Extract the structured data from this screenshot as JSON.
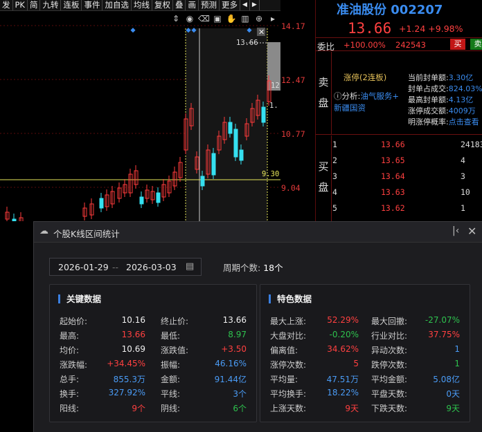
{
  "toolbar": {
    "items": [
      "发",
      "PK",
      "简",
      "九转",
      "连板",
      "事件",
      "加自选",
      "均线",
      "复权",
      "叠",
      "画",
      "预测",
      "更多"
    ],
    "nav_prev": "◀",
    "nav_next": "▶"
  },
  "chart": {
    "price_labels": [
      "14.17",
      "12.47",
      "10.77",
      "9.04"
    ],
    "marker_high": "13.66",
    "marker_mid": "12",
    "marker_one": "1.",
    "marker_low": "9.30"
  },
  "quote": {
    "title": "准油股份 002207",
    "price": "13.66",
    "change": "+1.24",
    "change_pct": "+9.98%",
    "weibi_label": "委比",
    "weibi": "+100.00%",
    "weicha": "242543",
    "sell_btn": "买",
    "buy_btn": "卖",
    "sell_side": "卖盘",
    "buy_side": "买盘",
    "limit_status": "涨停(2连板)",
    "analysis_prefix": "分析:",
    "analysis_value": "油气服务+",
    "analysis_value2": "新疆国资",
    "fields": [
      {
        "label": "当前封单额:",
        "value": "3.30亿"
      },
      {
        "label": "封单占成交:",
        "value": "824.03%"
      },
      {
        "label": "最高封单额:",
        "value": "4.13亿"
      },
      {
        "label": "涨停成交额:",
        "value": "4009万"
      },
      {
        "label": "明涨停概率:",
        "value": "点击查看"
      }
    ],
    "bids": [
      {
        "i": "1",
        "p": "13.66",
        "q": "24183"
      },
      {
        "i": "2",
        "p": "13.65",
        "q": "4"
      },
      {
        "i": "3",
        "p": "13.64",
        "q": "3"
      },
      {
        "i": "4",
        "p": "13.63",
        "q": "10"
      },
      {
        "i": "5",
        "p": "13.62",
        "q": "1"
      }
    ]
  },
  "dialog": {
    "title": "个股K线区间统计",
    "start_date": "2026-01-29",
    "sep": "--",
    "end_date": "2026-03-03",
    "period_label": "周期个数:",
    "period_value": "18个",
    "key_title": "关键数据",
    "special_title": "特色数据",
    "key_rows": [
      {
        "l1": "起始价:",
        "v1": "10.16",
        "c1": "wht",
        "l2": "终止价:",
        "v2": "13.66",
        "c2": "wht"
      },
      {
        "l1": "最高:",
        "v1": "13.66",
        "c1": "red",
        "l2": "最低:",
        "v2": "8.97",
        "c2": "grn"
      },
      {
        "l1": "均价:",
        "v1": "10.69",
        "c1": "wht",
        "l2": "涨跌值:",
        "v2": "+3.50",
        "c2": "red"
      },
      {
        "l1": "涨跌幅:",
        "v1": "+34.45%",
        "c1": "red",
        "l2": "振幅:",
        "v2": "46.16%",
        "c2": "blu"
      },
      {
        "l1": "总手:",
        "v1": "855.3万",
        "c1": "blu",
        "l2": "金额:",
        "v2": "91.44亿",
        "c2": "blu"
      },
      {
        "l1": "换手:",
        "v1": "327.92%",
        "c1": "blu",
        "l2": "平线:",
        "v2": "3个",
        "c2": "blu"
      },
      {
        "l1": "阳线:",
        "v1": "9个",
        "c1": "red",
        "l2": "阴线:",
        "v2": "6个",
        "c2": "grn"
      }
    ],
    "special_rows": [
      {
        "l1": "最大上涨:",
        "v1": "52.29%",
        "c1": "red",
        "l2": "最大回撤:",
        "v2": "-27.07%",
        "c2": "grn"
      },
      {
        "l1": "大盘对比:",
        "v1": "-0.20%",
        "c1": "grn",
        "l2": "行业对比:",
        "v2": "37.75%",
        "c2": "red"
      },
      {
        "l1": "偏离值:",
        "v1": "34.62%",
        "c1": "red",
        "l2": "异动次数:",
        "v2": "1",
        "c2": "blu"
      },
      {
        "l1": "涨停次数:",
        "v1": "5",
        "c1": "red",
        "l2": "跌停次数:",
        "v2": "1",
        "c2": "grn"
      },
      {
        "l1": "平均量:",
        "v1": "47.51万",
        "c1": "blu",
        "l2": "平均金额:",
        "v2": "5.08亿",
        "c2": "blu"
      },
      {
        "l1": "平均换手:",
        "v1": "18.22%",
        "c1": "blu",
        "l2": "平盘天数:",
        "v2": "0天",
        "c2": "blu"
      },
      {
        "l1": "上涨天数:",
        "v1": "9天",
        "c1": "red",
        "l2": "下跌天数:",
        "v2": "9天",
        "c2": "grn"
      }
    ]
  }
}
